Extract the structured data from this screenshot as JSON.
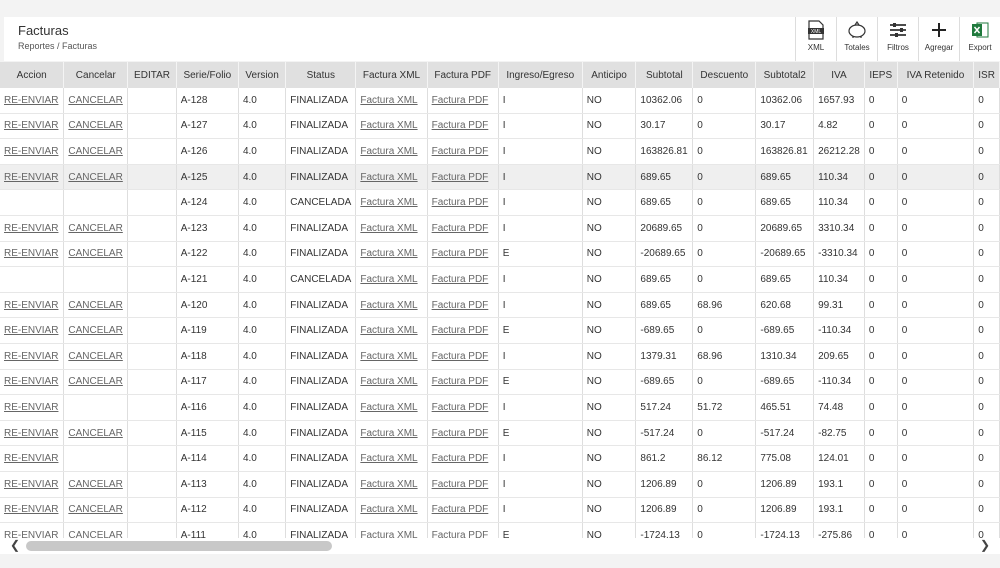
{
  "header": {
    "title": "Facturas",
    "breadcrumb": "Reportes / Facturas"
  },
  "toolbar": [
    {
      "label": "XML",
      "icon": "xml-file-icon"
    },
    {
      "label": "Totales",
      "icon": "piggy-bank-icon"
    },
    {
      "label": "Filtros",
      "icon": "sliders-icon"
    },
    {
      "label": "Agregar",
      "icon": "plus-icon"
    },
    {
      "label": "Export",
      "icon": "excel-icon"
    }
  ],
  "columns": [
    "Accion",
    "Cancelar",
    "EDITAR",
    "Serie/Folio",
    "Version",
    "Status",
    "Factura XML",
    "Factura PDF",
    "Ingreso/Egreso",
    "Anticipo",
    "Subtotal",
    "Descuento",
    "Subtotal2",
    "IVA",
    "IEPS",
    "IVA Retenido",
    "ISR"
  ],
  "rows": [
    [
      "RE-ENVIAR",
      "CANCELAR",
      "",
      "A-128",
      "4.0",
      "FINALIZADA",
      "Factura XML",
      "Factura PDF",
      "I",
      "NO",
      "10362.06",
      "0",
      "10362.06",
      "1657.93",
      "0",
      "0",
      "0"
    ],
    [
      "RE-ENVIAR",
      "CANCELAR",
      "",
      "A-127",
      "4.0",
      "FINALIZADA",
      "Factura XML",
      "Factura PDF",
      "I",
      "NO",
      "30.17",
      "0",
      "30.17",
      "4.82",
      "0",
      "0",
      "0"
    ],
    [
      "RE-ENVIAR",
      "CANCELAR",
      "",
      "A-126",
      "4.0",
      "FINALIZADA",
      "Factura XML",
      "Factura PDF",
      "I",
      "NO",
      "163826.81",
      "0",
      "163826.81",
      "26212.28",
      "0",
      "0",
      "0"
    ],
    [
      "RE-ENVIAR",
      "CANCELAR",
      "",
      "A-125",
      "4.0",
      "FINALIZADA",
      "Factura XML",
      "Factura PDF",
      "I",
      "NO",
      "689.65",
      "0",
      "689.65",
      "110.34",
      "0",
      "0",
      "0"
    ],
    [
      "",
      "",
      "",
      "A-124",
      "4.0",
      "CANCELADA",
      "Factura XML",
      "Factura PDF",
      "I",
      "NO",
      "689.65",
      "0",
      "689.65",
      "110.34",
      "0",
      "0",
      "0"
    ],
    [
      "RE-ENVIAR",
      "CANCELAR",
      "",
      "A-123",
      "4.0",
      "FINALIZADA",
      "Factura XML",
      "Factura PDF",
      "I",
      "NO",
      "20689.65",
      "0",
      "20689.65",
      "3310.34",
      "0",
      "0",
      "0"
    ],
    [
      "RE-ENVIAR",
      "CANCELAR",
      "",
      "A-122",
      "4.0",
      "FINALIZADA",
      "Factura XML",
      "Factura PDF",
      "E",
      "NO",
      "-20689.65",
      "0",
      "-20689.65",
      "-3310.34",
      "0",
      "0",
      "0"
    ],
    [
      "",
      "",
      "",
      "A-121",
      "4.0",
      "CANCELADA",
      "Factura XML",
      "Factura PDF",
      "I",
      "NO",
      "689.65",
      "0",
      "689.65",
      "110.34",
      "0",
      "0",
      "0"
    ],
    [
      "RE-ENVIAR",
      "CANCELAR",
      "",
      "A-120",
      "4.0",
      "FINALIZADA",
      "Factura XML",
      "Factura PDF",
      "I",
      "NO",
      "689.65",
      "68.96",
      "620.68",
      "99.31",
      "0",
      "0",
      "0"
    ],
    [
      "RE-ENVIAR",
      "CANCELAR",
      "",
      "A-119",
      "4.0",
      "FINALIZADA",
      "Factura XML",
      "Factura PDF",
      "E",
      "NO",
      "-689.65",
      "0",
      "-689.65",
      "-110.34",
      "0",
      "0",
      "0"
    ],
    [
      "RE-ENVIAR",
      "CANCELAR",
      "",
      "A-118",
      "4.0",
      "FINALIZADA",
      "Factura XML",
      "Factura PDF",
      "I",
      "NO",
      "1379.31",
      "68.96",
      "1310.34",
      "209.65",
      "0",
      "0",
      "0"
    ],
    [
      "RE-ENVIAR",
      "CANCELAR",
      "",
      "A-117",
      "4.0",
      "FINALIZADA",
      "Factura XML",
      "Factura PDF",
      "E",
      "NO",
      "-689.65",
      "0",
      "-689.65",
      "-110.34",
      "0",
      "0",
      "0"
    ],
    [
      "RE-ENVIAR",
      "",
      "",
      "A-116",
      "4.0",
      "FINALIZADA",
      "Factura XML",
      "Factura PDF",
      "I",
      "NO",
      "517.24",
      "51.72",
      "465.51",
      "74.48",
      "0",
      "0",
      "0"
    ],
    [
      "RE-ENVIAR",
      "CANCELAR",
      "",
      "A-115",
      "4.0",
      "FINALIZADA",
      "Factura XML",
      "Factura PDF",
      "E",
      "NO",
      "-517.24",
      "0",
      "-517.24",
      "-82.75",
      "0",
      "0",
      "0"
    ],
    [
      "RE-ENVIAR",
      "",
      "",
      "A-114",
      "4.0",
      "FINALIZADA",
      "Factura XML",
      "Factura PDF",
      "I",
      "NO",
      "861.2",
      "86.12",
      "775.08",
      "124.01",
      "0",
      "0",
      "0"
    ],
    [
      "RE-ENVIAR",
      "CANCELAR",
      "",
      "A-113",
      "4.0",
      "FINALIZADA",
      "Factura XML",
      "Factura PDF",
      "I",
      "NO",
      "1206.89",
      "0",
      "1206.89",
      "193.1",
      "0",
      "0",
      "0"
    ],
    [
      "RE-ENVIAR",
      "CANCELAR",
      "",
      "A-112",
      "4.0",
      "FINALIZADA",
      "Factura XML",
      "Factura PDF",
      "I",
      "NO",
      "1206.89",
      "0",
      "1206.89",
      "193.1",
      "0",
      "0",
      "0"
    ],
    [
      "RE-ENVIAR",
      "CANCELAR",
      "",
      "A-111",
      "4.0",
      "FINALIZADA",
      "Factura XML",
      "Factura PDF",
      "E",
      "NO",
      "-1724.13",
      "0",
      "-1724.13",
      "-275.86",
      "0",
      "0",
      "0"
    ]
  ],
  "highlighted_row": "A-125",
  "colors": {
    "header_bg": "#e0e0e0",
    "link": "#666666",
    "highlight_row": "#efefef",
    "excel_green": "#1f7a3d"
  }
}
